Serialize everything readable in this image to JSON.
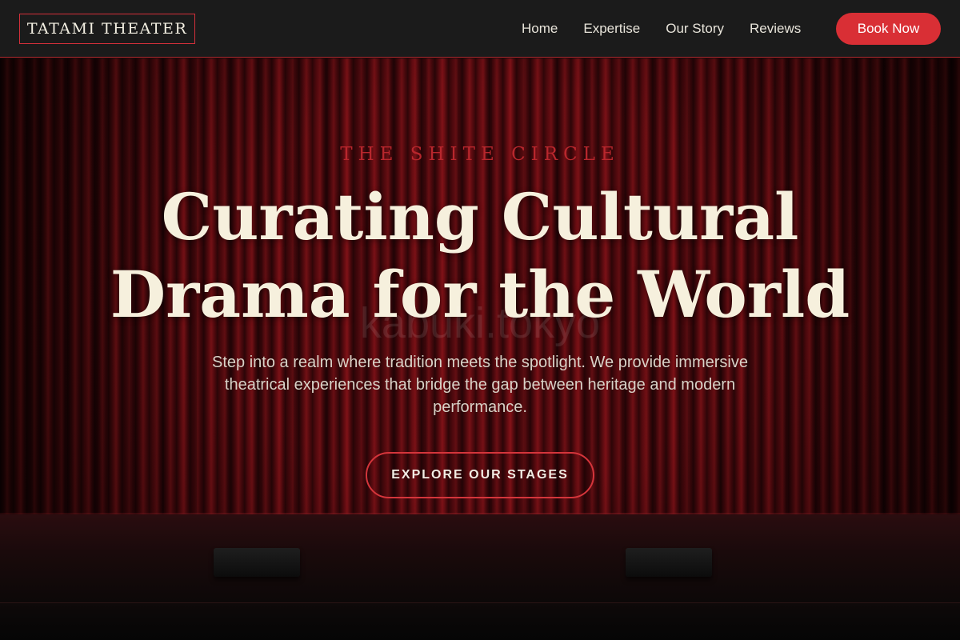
{
  "brand": {
    "logo_text": "TATAMI THEATER"
  },
  "nav": {
    "links": [
      "Home",
      "Expertise",
      "Our Story",
      "Reviews"
    ],
    "cta_label": "Book Now"
  },
  "hero": {
    "eyebrow": "THE SHITE CIRCLE",
    "headline_line1": "Curating Cultural",
    "headline_line2": "Drama for the World",
    "watermark": "kabuki.tokyo",
    "subtext": "Step into a realm where tradition meets the spotlight. We provide immersive theatrical experiences that bridge the gap between heritage and modern performance.",
    "cta_label": "EXPLORE OUR STAGES"
  },
  "colors": {
    "accent": "#d92f35",
    "eyebrow": "#b8272d",
    "headline": "#f6f0dd",
    "navbar_bg": "#1b1b1b"
  }
}
